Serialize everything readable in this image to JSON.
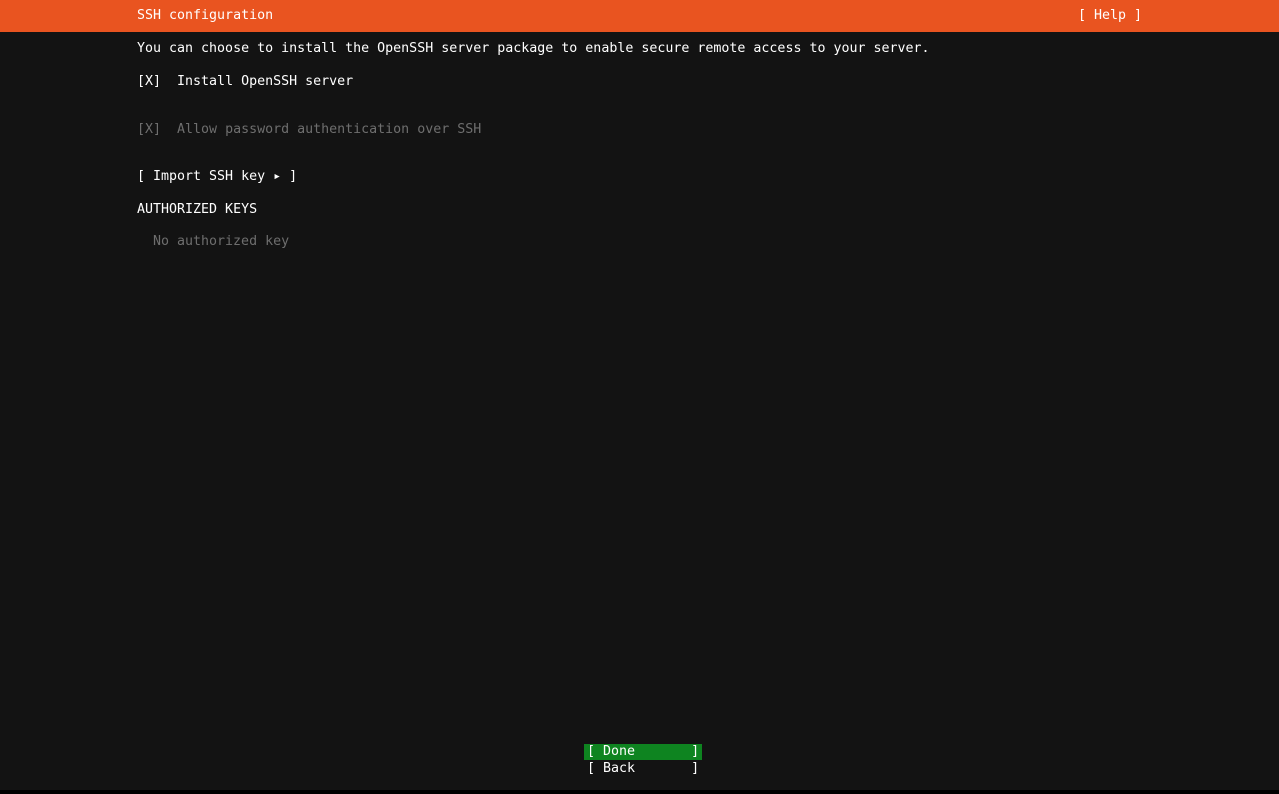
{
  "header": {
    "title": "SSH configuration",
    "help_button_label": "[ Help ]"
  },
  "content": {
    "intro": "You can choose to install the OpenSSH server package to enable secure remote access to your server.",
    "install_checkbox": {
      "mark": "[X]",
      "label": "Install OpenSSH server"
    },
    "password_checkbox": {
      "mark": "[X]",
      "label": "Allow password authentication over SSH"
    },
    "import_button_label": "[ Import SSH key ▸ ]",
    "authorized_keys": {
      "heading": "AUTHORIZED KEYS",
      "empty_message": "No authorized key"
    }
  },
  "footer": {
    "done_button_label": "[ Done       ]",
    "back_button_label": "[ Back       ]"
  },
  "colors": {
    "header_orange": "#E95420",
    "confirm_green": "#0E8420",
    "background": "#131313",
    "text": "#FFFFFF",
    "disabled_text": "#6E6E6E"
  }
}
